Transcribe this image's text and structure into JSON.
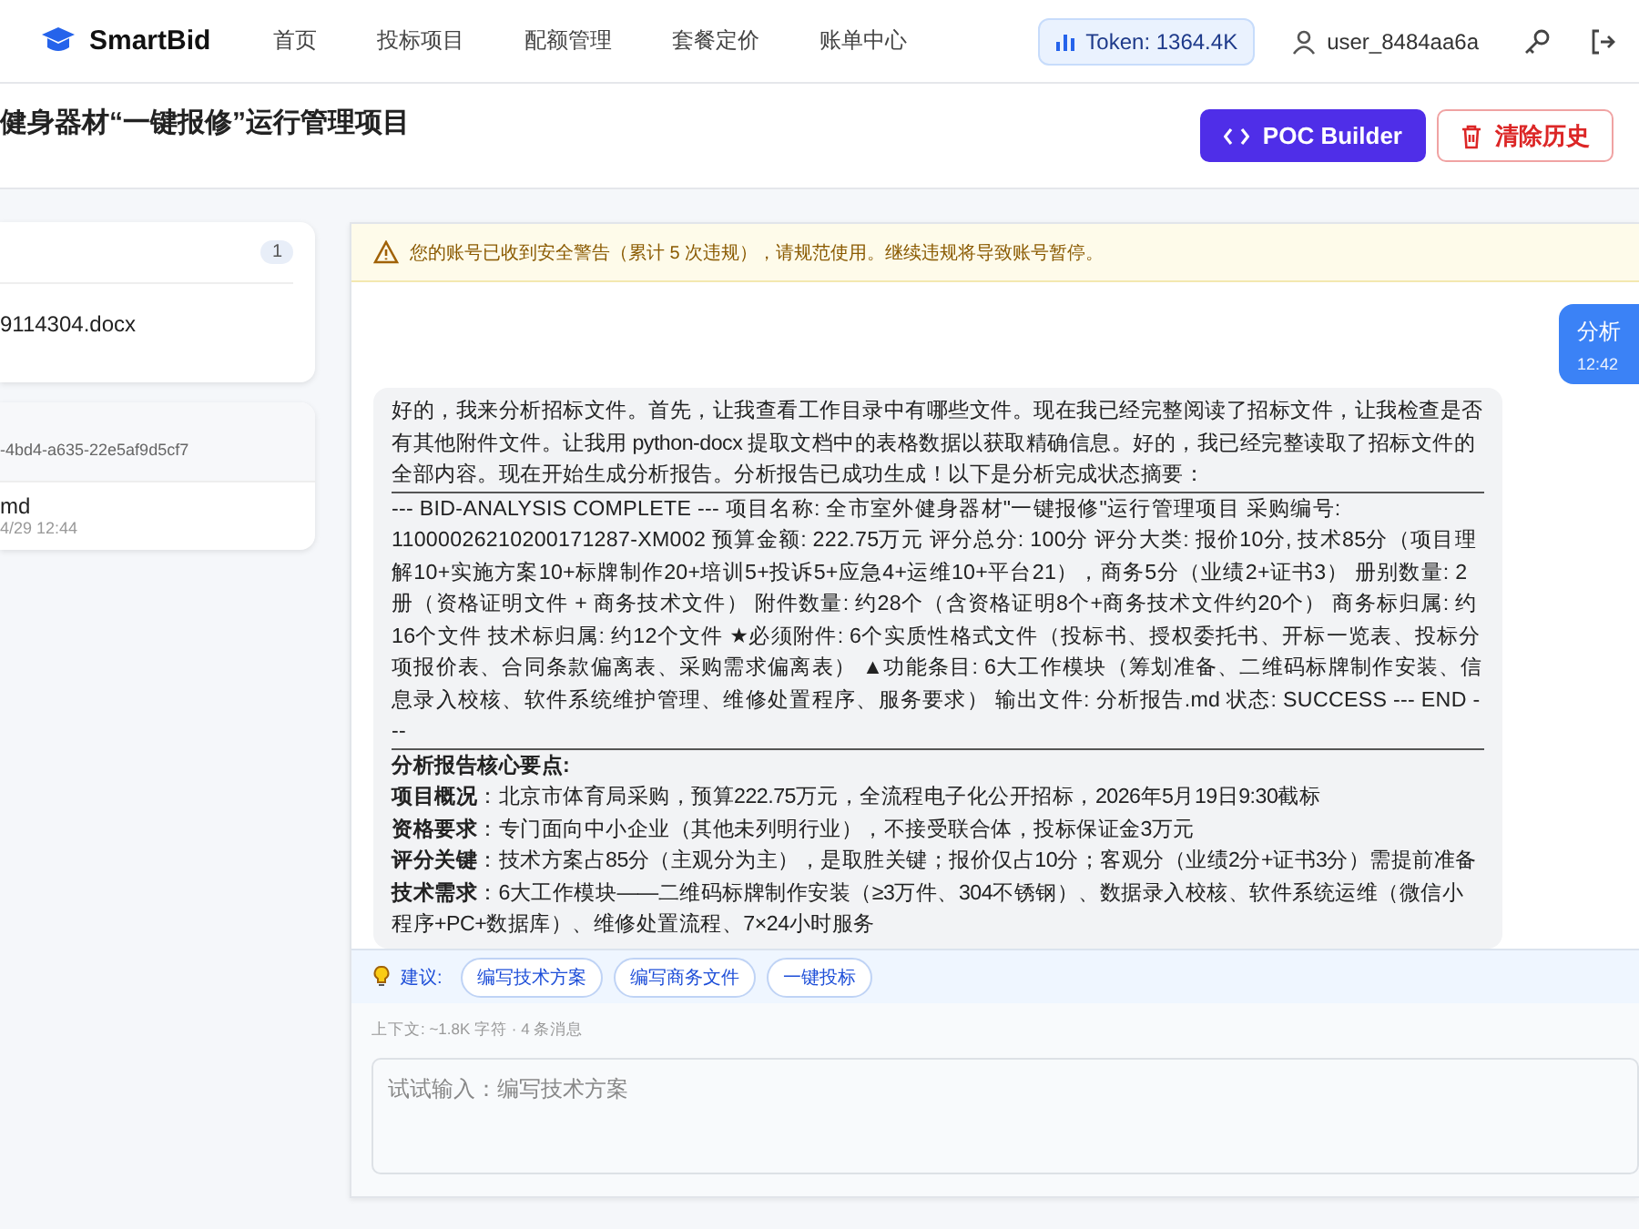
{
  "nav": {
    "brand": "SmartBid",
    "links": [
      {
        "label": "首页",
        "selected": false
      },
      {
        "label": "投标项目",
        "selected": false
      },
      {
        "label": "配额管理",
        "selected": false
      },
      {
        "label": "套餐定价",
        "selected": false
      },
      {
        "label": "账单中心",
        "selected": false
      }
    ],
    "token": "Token: 1364.4K",
    "user": "user_8484aa6a"
  },
  "project": {
    "title": "健身器材“一键报修”运行管理项目",
    "buttons": [
      {
        "kind": "primary",
        "label": "POC Builder"
      },
      {
        "kind": "danger",
        "label": "清除历史"
      }
    ]
  },
  "sidebar": {
    "files": {
      "count": "1",
      "items": [
        {
          "name": "9114304.docx"
        }
      ]
    },
    "outputs": {
      "session": "-4bd4-a635-22e5af9d5cf7",
      "items": [
        {
          "name": "md",
          "time": "4/29 12:44"
        }
      ]
    }
  },
  "warning": "您的账号已收到安全警告（累计 5 次违规），请规范使用。继续违规将导致账号暂停。",
  "messages": [
    {
      "kind": "user",
      "text": "分析",
      "time": "12:42"
    },
    {
      "kind": "assistant",
      "intro": "好的，我来分析招标文件。首先，让我查看工作目录中有哪些文件。现在我已经完整阅读了招标文件，让我检查是否有其他附件文件。让我用 python-docx 提取文档中的表格数据以获取精确信息。好的，我已经完整读取了招标文件的全部内容。现在开始生成分析报告。分析报告已成功生成！以下是分析完成状态摘要：",
      "summary": "--- BID-ANALYSIS COMPLETE --- 项目名称: 全市室外健身器材\"一键报修\"运行管理项目 采购编号: 11000026210200171287-XM002 预算金额: 222.75万元 评分总分: 100分 评分大类: 报价10分, 技术85分（项目理解10+实施方案10+标牌制作20+培训5+投诉5+应急4+运维10+平台21），商务5分（业绩2+证书3） 册别数量: 2册（资格证明文件 + 商务技术文件） 附件数量: 约28个（含资格证明8个+商务技术文件约20个） 商务标归属: 约16个文件 技术标归属: 约12个文件 ★必须附件: 6个实质性格式文件（投标书、授权委托书、开标一览表、投标分项报价表、合同条款偏离表、采购需求偏离表） ▲功能条目: 6大工作模块（筹划准备、二维码标牌制作安装、信息录入校核、软件系统维护管理、维修处置程序、服务要求） 输出文件: 分析报告.md 状态: SUCCESS --- END ---",
      "heading": "分析报告核心要点:",
      "points": [
        "**项目概况**：北京市体育局采购，预算222.75万元，全流程电子化公开招标，2026年5月19日9:30截标",
        "**资格要求**：专门面向中小企业（其他未列明行业），不接受联合体，投标保证金3万元",
        "**评分关键**：技术方案占85分（主观分为主），是取胜关键；报价仅占10分；客观分（业绩2分+证书3分）需提前准备",
        "**技术需求**：6大工作模块——二维码标牌制作安装（≥3万件、304不锈钢）、数据录入校核、软件系统运维（微信小程序+PC+数据库）、维修处置流程、7×24小时服务"
      ]
    }
  ],
  "suggestions": {
    "label": "建议:",
    "items": [
      "编写技术方案",
      "编写商务文件",
      "一键投标"
    ]
  },
  "context": "上下文: ~1.8K 字符 · 4 条消息",
  "input": {
    "placeholder": "试试输入：编写技术方案"
  }
}
